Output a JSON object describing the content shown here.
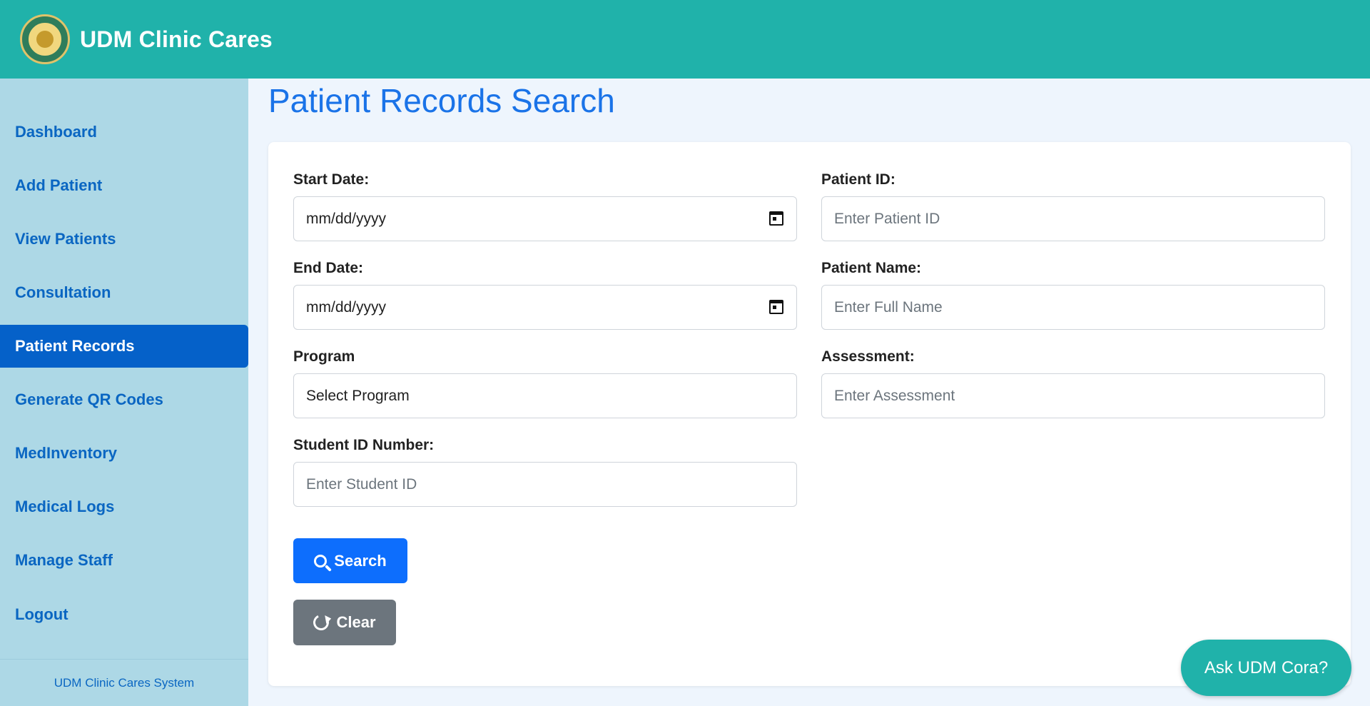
{
  "header": {
    "brand": "UDM Clinic Cares",
    "logo_icon": "udm-seal-logo"
  },
  "sidebar": {
    "items": [
      {
        "label": "Dashboard",
        "active": false
      },
      {
        "label": "Add Patient",
        "active": false
      },
      {
        "label": "View Patients",
        "active": false
      },
      {
        "label": "Consultation",
        "active": false
      },
      {
        "label": "Patient Records",
        "active": true
      },
      {
        "label": "Generate QR Codes",
        "active": false
      },
      {
        "label": "MedInventory",
        "active": false
      },
      {
        "label": "Medical Logs",
        "active": false
      },
      {
        "label": "Manage Staff",
        "active": false
      },
      {
        "label": "Logout",
        "active": false
      }
    ],
    "footer": "UDM Clinic Cares System"
  },
  "main": {
    "title": "Patient Records Search",
    "form": {
      "start_date": {
        "label": "Start Date:",
        "value": "mm/dd/yyyy"
      },
      "end_date": {
        "label": "End Date:",
        "value": "mm/dd/yyyy"
      },
      "program": {
        "label": "Program",
        "value": "Select Program"
      },
      "student_id": {
        "label": "Student ID Number:",
        "placeholder": "Enter Student ID"
      },
      "patient_id": {
        "label": "Patient ID:",
        "placeholder": "Enter Patient ID"
      },
      "patient_name": {
        "label": "Patient Name:",
        "placeholder": "Enter Full Name"
      },
      "assessment": {
        "label": "Assessment:",
        "placeholder": "Enter Assessment"
      }
    },
    "buttons": {
      "search": "Search",
      "clear": "Clear"
    }
  },
  "chatbot": {
    "label": "Ask UDM Cora?"
  },
  "colors": {
    "header": "#20b2aa",
    "sidebar": "#add8e6",
    "active_nav": "#0561c9",
    "primary": "#0d6efd",
    "secondary": "#6c757d"
  }
}
